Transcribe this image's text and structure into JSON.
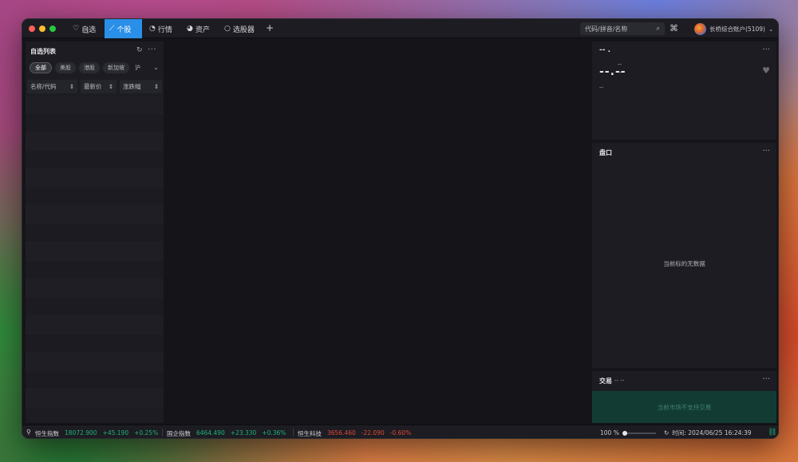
{
  "nav": {
    "tabs": [
      {
        "icon": "heart-icon",
        "label": "自选"
      },
      {
        "icon": "stock-icon",
        "label": "个股"
      },
      {
        "icon": "market-icon",
        "label": "行情"
      },
      {
        "icon": "assets-icon",
        "label": "资产"
      },
      {
        "icon": "screener-icon",
        "label": "选股器"
      }
    ],
    "active_tab": "个股",
    "add_label": "+",
    "search_placeholder": "代码/拼音/名称",
    "account_label": "长桥综合账户(5109)"
  },
  "watchlist": {
    "title": "自选列表",
    "filters": [
      "全部",
      "美股",
      "港股",
      "新加坡",
      "沪"
    ],
    "active_filter": "全部",
    "columns": [
      "名称/代码",
      "最新价",
      "涨跌幅"
    ]
  },
  "quote": {
    "code": "-- .",
    "price": "--.--",
    "change1": "--",
    "change2": "--",
    "sub": "--"
  },
  "order_book": {
    "title": "盘口",
    "empty_text": "当前标的无数据"
  },
  "trade": {
    "title": "交易",
    "subtitle": "-- --",
    "notice": "当前市场不支持交易"
  },
  "status": {
    "indices": [
      {
        "name": "恒生指数",
        "value": "18072.900",
        "change": "+45.190",
        "pct": "+0.25%",
        "dir": "up"
      },
      {
        "name": "国企指数",
        "value": "6464.490",
        "change": "+23.330",
        "pct": "+0.36%",
        "dir": "up"
      },
      {
        "name": "恒生科技",
        "value": "3656.460",
        "change": "-22.090",
        "pct": "-0.60%",
        "dir": "down"
      }
    ],
    "zoom": "100 %",
    "time": "时间: 2024/06/25 16:24:39"
  },
  "colors": {
    "accent": "#2a8fe8",
    "up": "#1fb37a",
    "down": "#e04a3a"
  }
}
